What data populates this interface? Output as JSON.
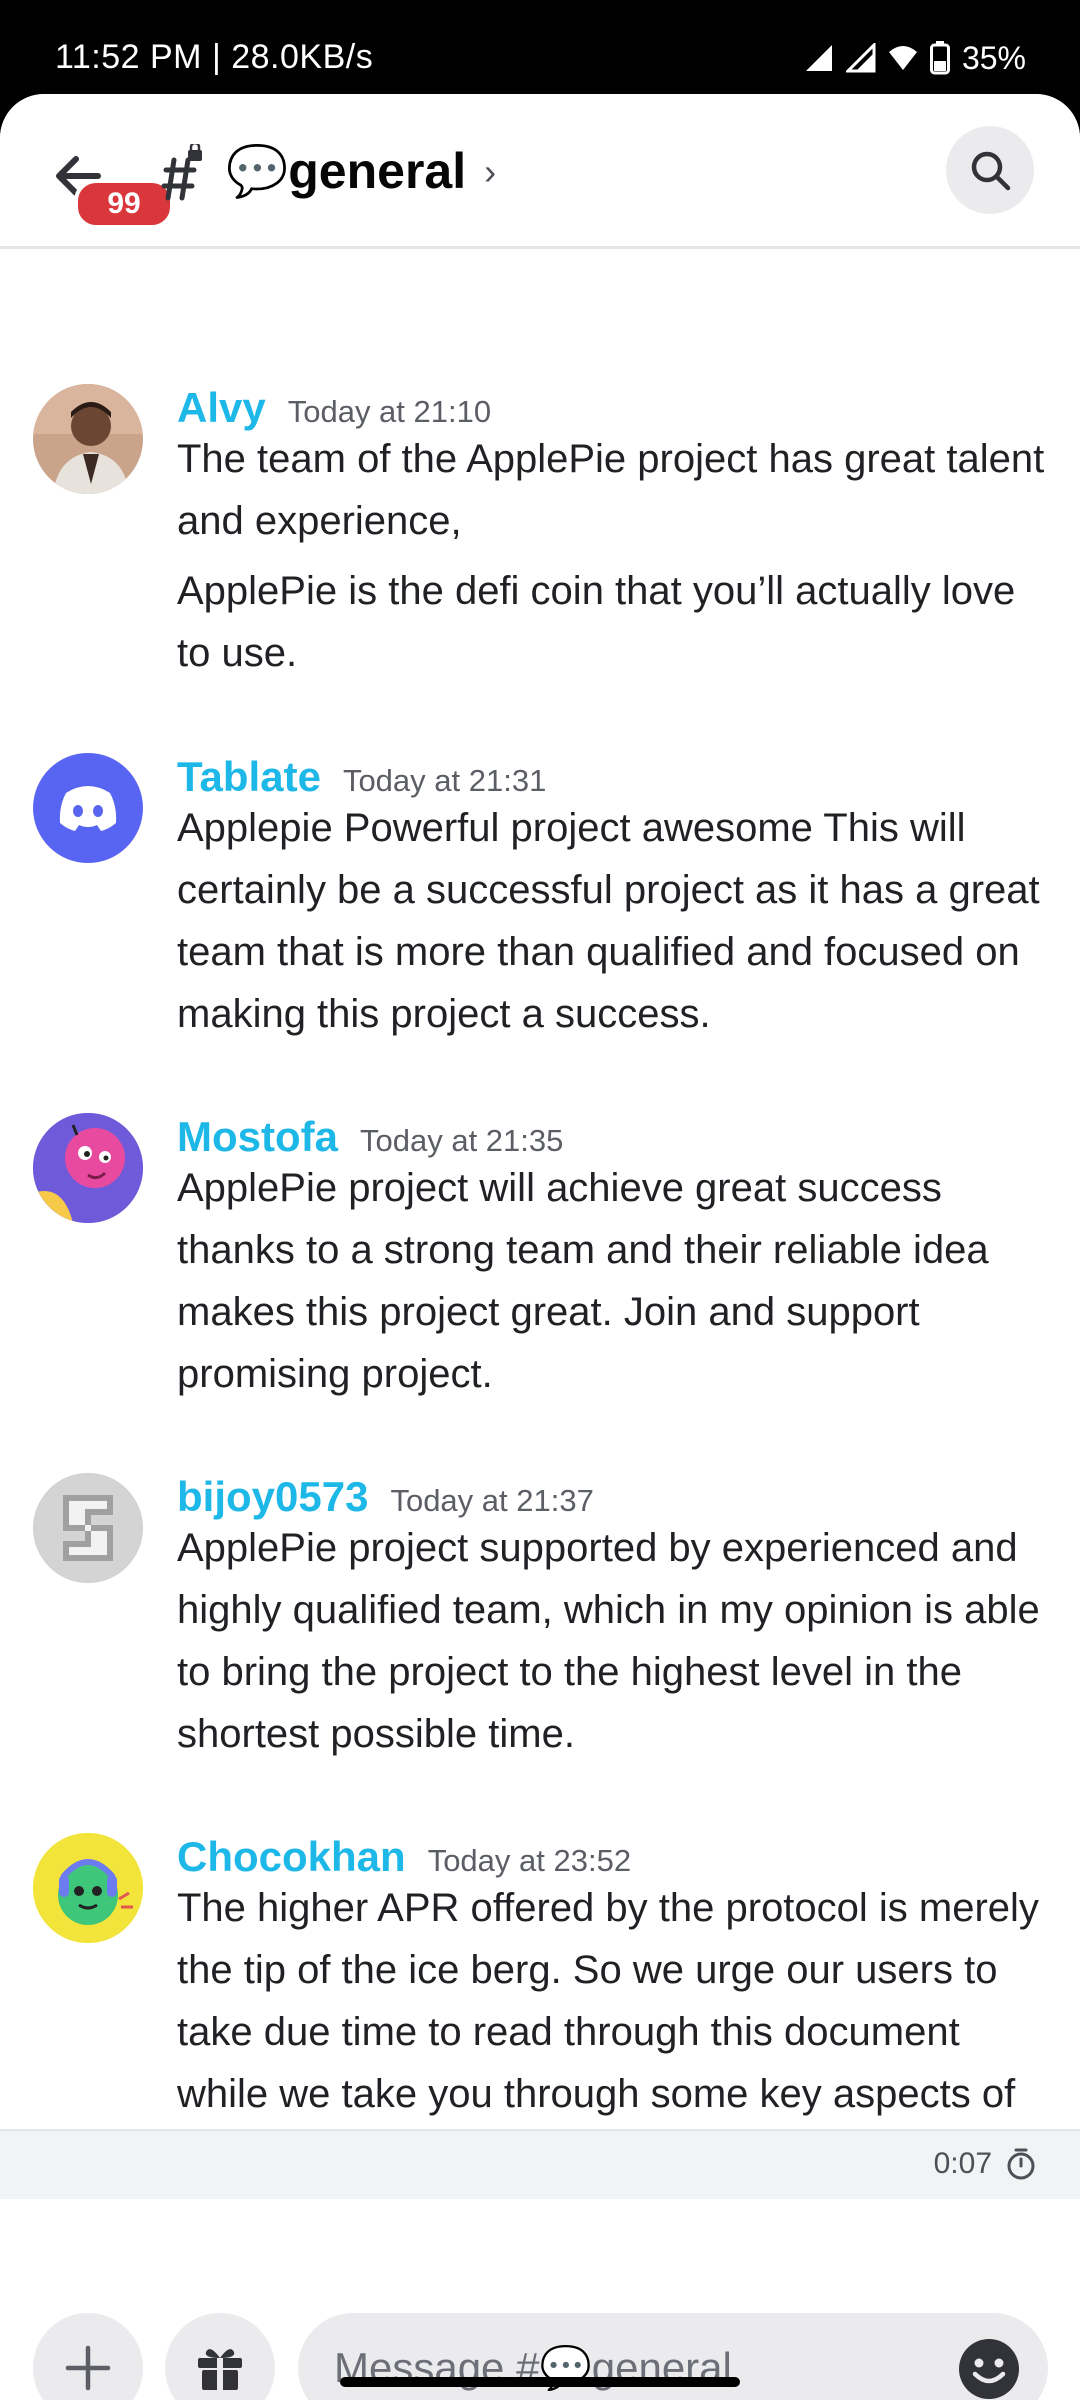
{
  "status_bar": {
    "time": "11:52 PM | 28.0KB/s",
    "battery": "35%",
    "icons": [
      "signal-icon",
      "signal-icon",
      "wifi-icon",
      "battery-icon"
    ]
  },
  "header": {
    "back_badge": "99",
    "channel_name": "💬general",
    "chevron": "›",
    "icons": [
      "back-arrow-icon",
      "hash-lock-icon",
      "search-icon"
    ]
  },
  "messages": [
    {
      "author": "Alvy",
      "timestamp": "Today at 21:10",
      "paragraphs": [
        "The team of the ApplePie project has great talent and experience,",
        "ApplePie is the defi coin that you’ll actually love to use."
      ]
    },
    {
      "author": "Tablate",
      "timestamp": "Today at 21:31",
      "paragraphs": [
        "Applepie Powerful project awesome This will certainly be a successful project as it has a great team that is more than qualified and focused on making this project a success."
      ]
    },
    {
      "author": "Mostofa",
      "timestamp": "Today at 21:35",
      "paragraphs": [
        "ApplePie project will achieve great success thanks to a strong team and their reliable idea makes this project great. Join and support promising project."
      ]
    },
    {
      "author": "bijoy0573",
      "timestamp": "Today at 21:37",
      "paragraphs": [
        "ApplePie project supported by experienced and highly qualified team, which in my opinion is able to bring the project to the highest level in the shortest possible time."
      ]
    },
    {
      "author": "Chocokhan",
      "timestamp": "Today at 23:52",
      "paragraphs": [
        "The higher APR offered by the protocol is merely the tip of the ice berg. So we urge our users to take due time to read through this document while we take you through some key aspects of it!"
      ]
    }
  ],
  "slowmode": {
    "timer": "0:07"
  },
  "composer": {
    "placeholder": "Message #💬general",
    "icons": [
      "plus-icon",
      "gift-icon",
      "emoji-icon"
    ]
  },
  "colors": {
    "accent_author": "#1db8e8",
    "badge": "#da373c",
    "discord_blurple": "#5865f2"
  }
}
